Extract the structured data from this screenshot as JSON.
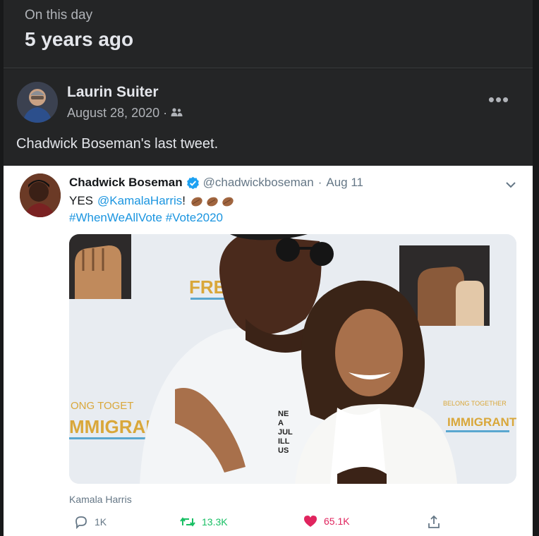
{
  "memory": {
    "kicker": "On this day",
    "title": "5 years ago"
  },
  "post": {
    "author": "Laurin Suiter",
    "date": "August 28, 2020",
    "separator": "·",
    "audience_icon": "friends-icon",
    "more_label": "•••",
    "caption": "Chadwick Boseman's last tweet."
  },
  "tweet": {
    "name": "Chadwick Boseman",
    "handle": "@chadwickboseman",
    "dot": "·",
    "date": "Aug 11",
    "line1_prefix": "YES",
    "mention": "@KamalaHarris",
    "exclaim": "!",
    "hashtags": "#WhenWeAllVote #Vote2020",
    "photo_credit": "Kamala Harris",
    "banner_left_1": "ONG TOGET",
    "banner_left_2": "MMIGRAN",
    "banner_center": "FREED",
    "banner_right_1": "BELONG TOGETHER",
    "banner_right_2": "IMMIGRANTS!",
    "shirt_text": "NE\nA\nJUL\nILL\nUS",
    "replies": "1K",
    "retweets": "13.3K",
    "likes": "65.1K",
    "colors": {
      "link": "#1b95e0",
      "retweet": "#17bf63",
      "like": "#e0245e"
    }
  }
}
